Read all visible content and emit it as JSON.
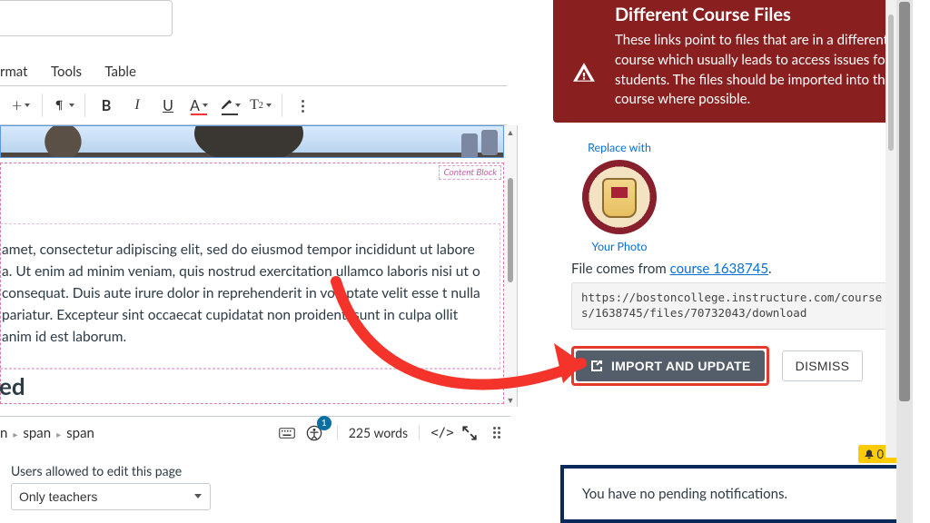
{
  "menu": {
    "format": "rmat",
    "tools": "Tools",
    "table": "Table"
  },
  "toolbar": {
    "t2": "T",
    "t2sup": "2"
  },
  "content": {
    "cb_label": "Content Block",
    "lorem": "amet, consectetur adipiscing elit, sed do eiusmod tempor incididunt ut labore a. Ut enim ad minim veniam, quis nostrud exercitation ullamco laboris nisi ut o consequat. Duis aute irure dolor in reprehenderit in voluptate velit esse t nulla pariatur. Excepteur sint occaecat cupidatat non proident, sunt in culpa ollit anim id est laborum.",
    "heading_fragment": "ed"
  },
  "status": {
    "bc1": "n",
    "bc2": "span",
    "bc3": "span",
    "a11y_badge": "1",
    "word_count": "225 words"
  },
  "perm": {
    "label": "Users allowed to edit this page",
    "value": "Only teachers"
  },
  "warn": {
    "title": "Different Course Files",
    "body": "These links point to files that are in a different course which usually leads to access issues for students. The files should be imported into this course where possible."
  },
  "replace": {
    "label": "Replace with",
    "caption": "Your Photo"
  },
  "file_from_prefix": "File comes from ",
  "file_from_link": "course 1638745",
  "file_from_suffix": ".",
  "url": "https://bostoncollege.instructure.com/courses/1638745/files/70732043/download",
  "actions": {
    "import": "IMPORT AND UPDATE",
    "dismiss": "DISMISS"
  },
  "notif": {
    "count": "0",
    "msg": "You have no pending notifications."
  }
}
